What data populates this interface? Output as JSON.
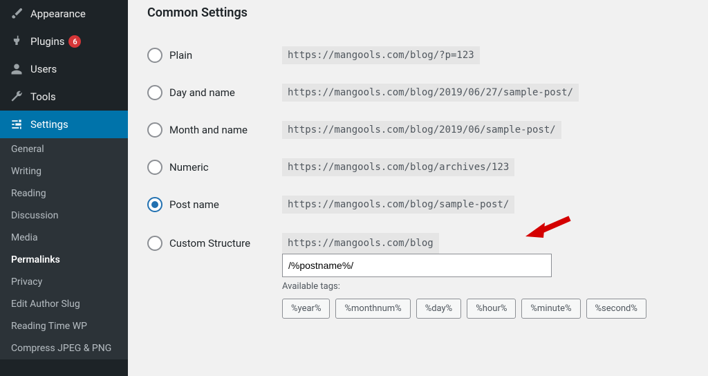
{
  "sidebar": {
    "primary": [
      {
        "label": "Appearance",
        "icon": "brush"
      },
      {
        "label": "Plugins",
        "icon": "plug",
        "badge": "6"
      },
      {
        "label": "Users",
        "icon": "user"
      },
      {
        "label": "Tools",
        "icon": "wrench"
      },
      {
        "label": "Settings",
        "icon": "sliders",
        "active": true
      }
    ],
    "sub": [
      "General",
      "Writing",
      "Reading",
      "Discussion",
      "Media",
      "Permalinks",
      "Privacy",
      "Edit Author Slug",
      "Reading Time WP",
      "Compress JPEG & PNG"
    ],
    "sub_active_index": 5
  },
  "page": {
    "heading": "Common Settings",
    "options": [
      {
        "key": "plain",
        "label": "Plain",
        "example": "https://mangools.com/blog/?p=123"
      },
      {
        "key": "day-name",
        "label": "Day and name",
        "example": "https://mangools.com/blog/2019/06/27/sample-post/"
      },
      {
        "key": "month-name",
        "label": "Month and name",
        "example": "https://mangools.com/blog/2019/06/sample-post/"
      },
      {
        "key": "numeric",
        "label": "Numeric",
        "example": "https://mangools.com/blog/archives/123"
      },
      {
        "key": "post-name",
        "label": "Post name",
        "example": "https://mangools.com/blog/sample-post/"
      }
    ],
    "selected_key": "post-name",
    "custom": {
      "label": "Custom Structure",
      "prefix": "https://mangools.com/blog",
      "value": "/%postname%/",
      "available_label": "Available tags:",
      "tags": [
        "%year%",
        "%monthnum%",
        "%day%",
        "%hour%",
        "%minute%",
        "%second%"
      ]
    },
    "arrow_color": "#d40000"
  }
}
